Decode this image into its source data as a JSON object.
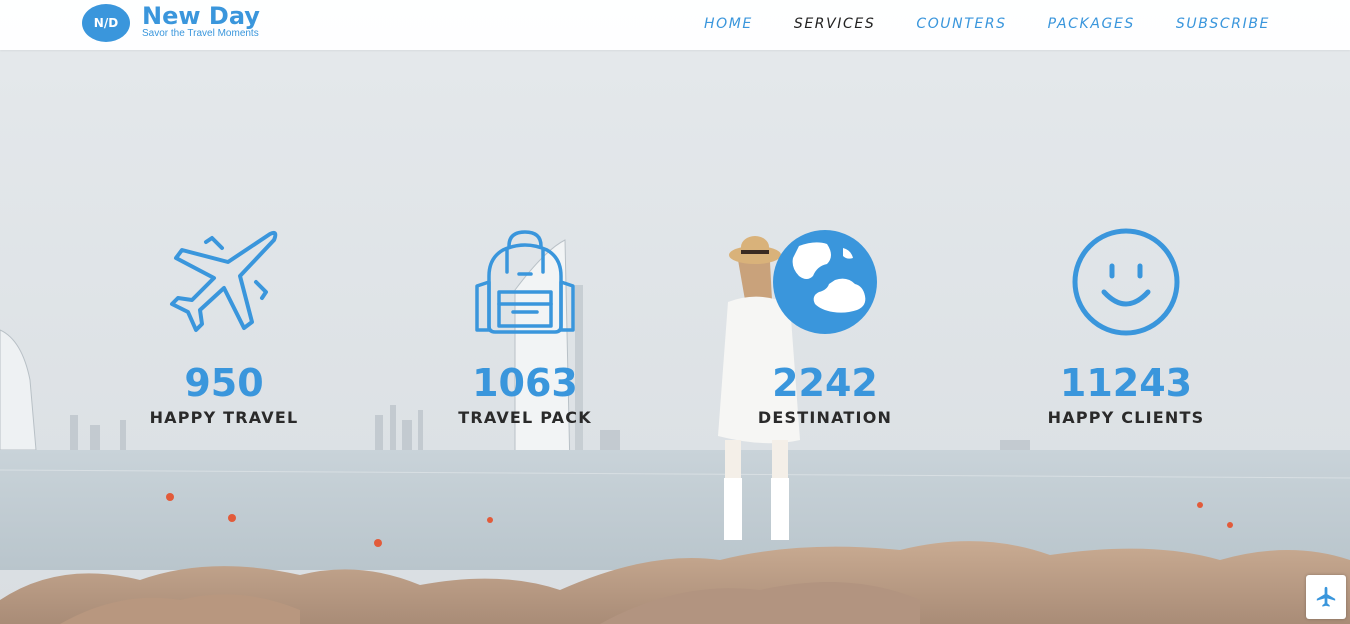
{
  "brand": {
    "badge": "N/D",
    "name": "New Day",
    "tagline": "Savor the Travel Moments",
    "accent_color": "#3a96dc"
  },
  "nav": {
    "items": [
      {
        "label": "HOME",
        "active": false
      },
      {
        "label": "SERVICES",
        "active": true
      },
      {
        "label": "COUNTERS",
        "active": false
      },
      {
        "label": "PACKAGES",
        "active": false
      },
      {
        "label": "SUBSCRIBE",
        "active": false
      }
    ]
  },
  "counters": [
    {
      "icon": "airplane-icon",
      "number": "950",
      "label": "HAPPY TRAVEL"
    },
    {
      "icon": "backpack-icon",
      "number": "1063",
      "label": "TRAVEL PACK"
    },
    {
      "icon": "globe-icon",
      "number": "2242",
      "label": "DESTINATION"
    },
    {
      "icon": "smiley-icon",
      "number": "11243",
      "label": "HAPPY CLIENTS"
    }
  ],
  "scroll_top": {
    "icon": "airplane-icon"
  }
}
